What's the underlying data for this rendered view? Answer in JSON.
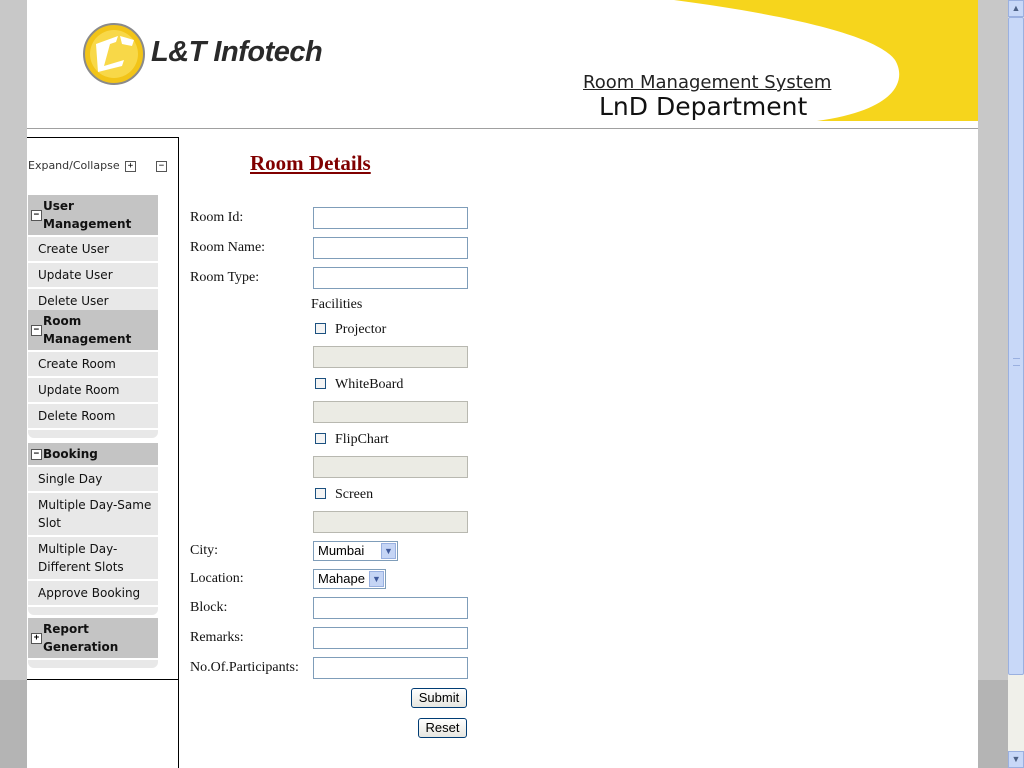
{
  "header": {
    "company": "L&T Infotech",
    "system_title": "Room Management System",
    "department": "LnD Department"
  },
  "sidebar": {
    "expand_collapse": "Expand/Collapse",
    "groups": [
      {
        "title": "User Management",
        "items": [
          "Create User",
          "Update User",
          "Delete User"
        ]
      },
      {
        "title": "Room Management",
        "items": [
          "Create Room",
          "Update Room",
          "Delete Room"
        ]
      },
      {
        "title": "Booking",
        "items": [
          "Single Day",
          "Multiple Day-Same Slot",
          "Multiple Day-Different Slots",
          "Approve Booking"
        ]
      },
      {
        "title": "Report Generation",
        "items": []
      }
    ]
  },
  "form": {
    "title": "Room Details",
    "room_id_label": "Room Id:",
    "room_name_label": "Room Name:",
    "room_type_label": "Room Type:",
    "facilities_label": "Facilities",
    "projector_label": "Projector",
    "whiteboard_label": "WhiteBoard",
    "flipchart_label": "FlipChart",
    "screen_label": "Screen",
    "city_label": "City:",
    "city_value": "Mumbai",
    "location_label": "Location:",
    "location_value": "Mahape",
    "block_label": "Block:",
    "remarks_label": "Remarks:",
    "participants_label": "No.Of.Participants:",
    "submit_label": "Submit",
    "reset_label": "Reset"
  },
  "colors": {
    "brand_yellow": "#f6d51c",
    "title_maroon": "#800000",
    "menu_header_gray": "#c4c4c4",
    "menu_item_gray": "#e8e8e8"
  }
}
